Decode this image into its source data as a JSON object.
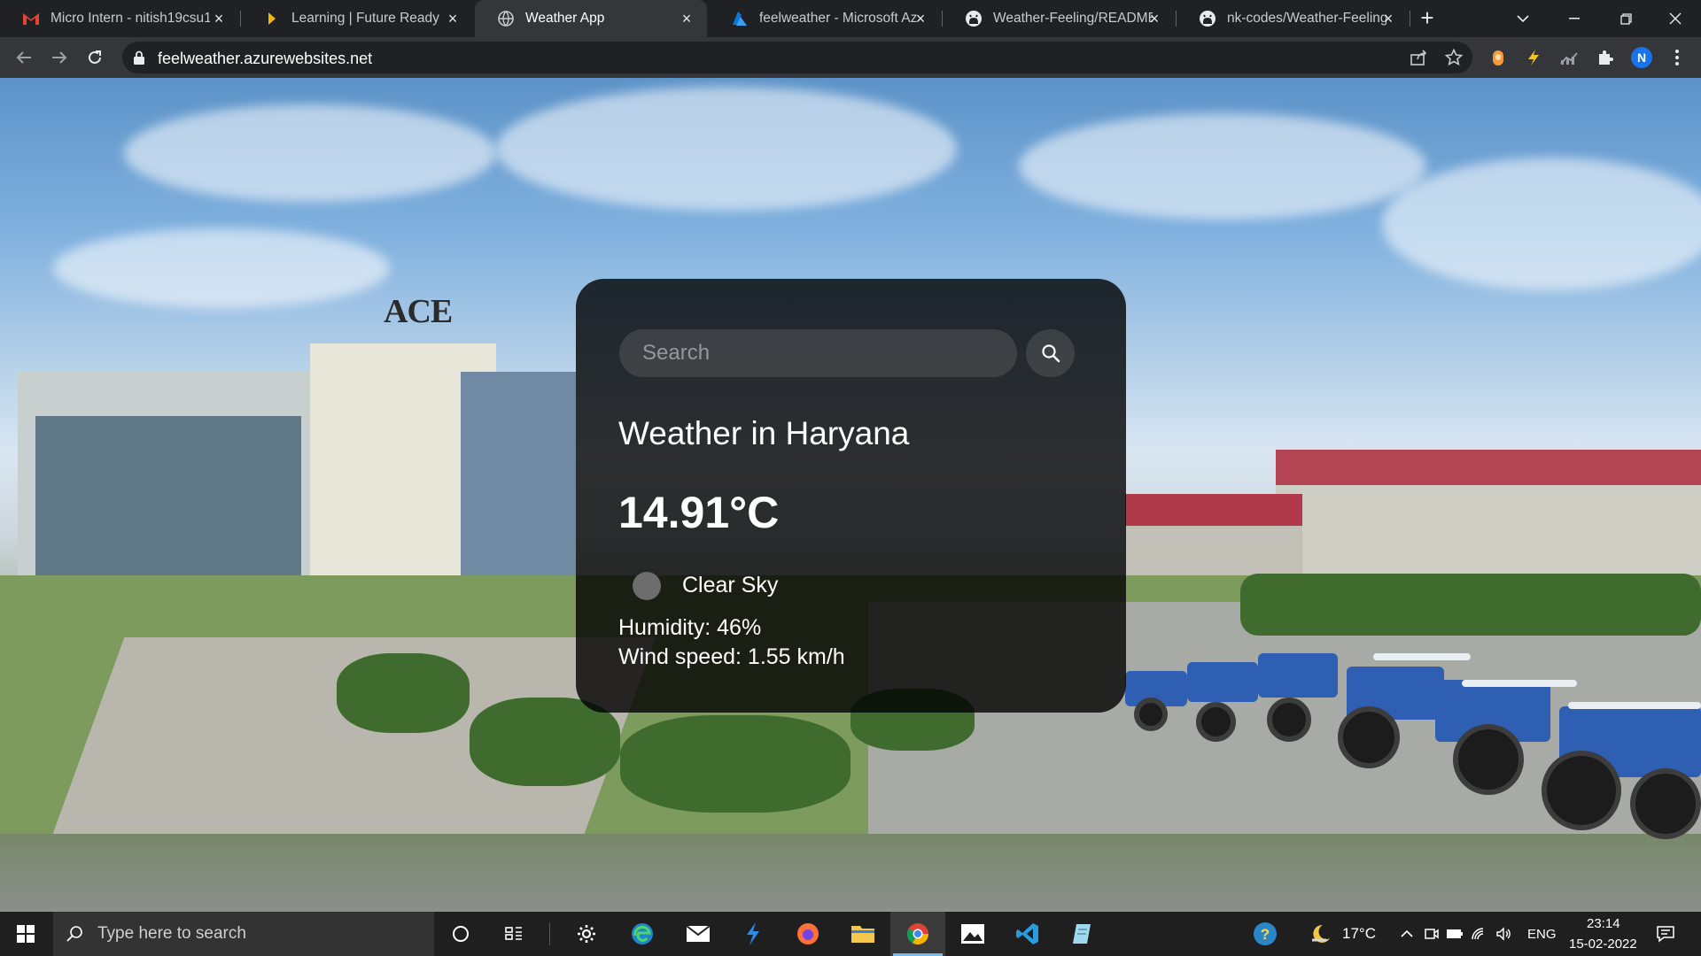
{
  "browser": {
    "tabs": [
      {
        "title": "Micro Intern - nitish19csu1",
        "icon": "gmail-icon",
        "active": false
      },
      {
        "title": "Learning | Future Ready Tal",
        "icon": "learning-icon",
        "active": false
      },
      {
        "title": "Weather App",
        "icon": "globe-icon",
        "active": true
      },
      {
        "title": "feelweather - Microsoft Az",
        "icon": "azure-icon",
        "active": false
      },
      {
        "title": "Weather-Feeling/README.",
        "icon": "github-icon",
        "active": false
      },
      {
        "title": "nk-codes/Weather-Feeling:",
        "icon": "github-icon",
        "active": false
      }
    ],
    "new_tab_label": "+",
    "url": "feelweather.azurewebsites.net",
    "profile_initial": "N"
  },
  "weather_app": {
    "search_placeholder": "Search",
    "search_value": "",
    "city_heading": "Weather in Haryana",
    "temperature": "14.91°C",
    "description": "Clear Sky",
    "humidity": "Humidity: 46%",
    "wind": "Wind speed: 1.55 km/h",
    "background_logo_text": "ACE"
  },
  "taskbar": {
    "search_placeholder": "Type here to search",
    "weather_temp": "17°C",
    "language": "ENG",
    "time": "23:14",
    "date": "15-02-2022",
    "pinned_icons": [
      "cortana-icon",
      "task-view-icon",
      "settings-icon",
      "edge-icon",
      "mail-icon",
      "azure-data-studio-icon",
      "firefox-icon",
      "file-explorer-icon",
      "chrome-icon",
      "photos-icon",
      "vscode-icon",
      "notepad-icon"
    ]
  },
  "colors": {
    "card_bg": "rgba(0,0,0,0.8)",
    "active_tab": "#35363a",
    "tab_strip": "#202124",
    "taskbar": "#1f1f1f"
  }
}
